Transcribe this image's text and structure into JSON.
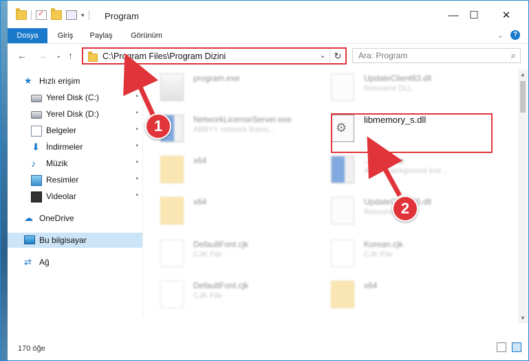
{
  "window": {
    "title": "Program",
    "minimize": "—",
    "maximize": "☐",
    "close": "✕"
  },
  "ribbon": {
    "tabs": [
      "Dosya",
      "Giriş",
      "Paylaş",
      "Görünüm"
    ],
    "collapse": "⌄",
    "help": "?"
  },
  "nav": {
    "back": "←",
    "forward": "→",
    "recent": "⌄",
    "up": "↑",
    "address": "C:\\Program Files\\Program Dizini",
    "dropdown": "⌄",
    "refresh": "↻",
    "search_placeholder": "Ara: Program",
    "search_icon": "⌕"
  },
  "sidebar": {
    "items": [
      {
        "label": "Hızlı erişim",
        "icon": "star-icon",
        "glyph": "★",
        "pinned": false
      },
      {
        "label": "Yerel Disk (C:)",
        "icon": "disk-icon",
        "glyph": "",
        "pinned": true
      },
      {
        "label": "Yerel Disk (D:)",
        "icon": "disk-icon",
        "glyph": "",
        "pinned": true
      },
      {
        "label": "Belgeler",
        "icon": "documents-icon",
        "glyph": "",
        "pinned": true
      },
      {
        "label": "İndirmeler",
        "icon": "downloads-icon",
        "glyph": "⬇",
        "pinned": true
      },
      {
        "label": "Müzik",
        "icon": "music-icon",
        "glyph": "♪",
        "pinned": true
      },
      {
        "label": "Resimler",
        "icon": "pictures-icon",
        "glyph": "",
        "pinned": true
      },
      {
        "label": "Videolar",
        "icon": "videos-icon",
        "glyph": "",
        "pinned": true
      },
      {
        "label": "OneDrive",
        "icon": "cloud-icon",
        "glyph": "☁",
        "pinned": false
      },
      {
        "label": "Bu bilgisayar",
        "icon": "computer-icon",
        "glyph": "",
        "pinned": false
      },
      {
        "label": "Ağ",
        "icon": "network-icon",
        "glyph": "⇄",
        "pinned": false
      }
    ],
    "pin_glyph": "📌"
  },
  "files": [
    {
      "name": "program.exe",
      "desc": "",
      "kind": "exe"
    },
    {
      "name": "UpdateClient63.dll",
      "desc": "Resource DLL",
      "kind": "dll"
    },
    {
      "name": "NetworkLicenseServer.exe",
      "desc": "ABBYY network licens...",
      "kind": "blue"
    },
    {
      "name": "libmemory_s.dll",
      "desc": "",
      "kind": "dll"
    },
    {
      "name": "x64",
      "desc": "",
      "kind": "folder"
    },
    {
      "name": "...exec.exe",
      "desc": "ABB... background exe...",
      "kind": "blue"
    },
    {
      "name": "x64",
      "desc": "",
      "kind": "folder"
    },
    {
      "name": "UpdateClient65.dll",
      "desc": "Resource DLL",
      "kind": "dll"
    },
    {
      "name": "DefaultFont.cjk",
      "desc": "CJK File",
      "kind": "blank"
    },
    {
      "name": "Korean.cjk",
      "desc": "CJK File",
      "kind": "blank"
    },
    {
      "name": "DefaultFont.cjk",
      "desc": "CJK File",
      "kind": "blank"
    },
    {
      "name": "x64",
      "desc": "",
      "kind": "folder"
    }
  ],
  "annotations": {
    "step1": "1",
    "step2": "2",
    "color": "#e0343a"
  },
  "status": {
    "count": "170 öğe"
  },
  "colors": {
    "accent": "#1979ca",
    "highlight": "#e0343a",
    "selected": "#cce4f7"
  }
}
